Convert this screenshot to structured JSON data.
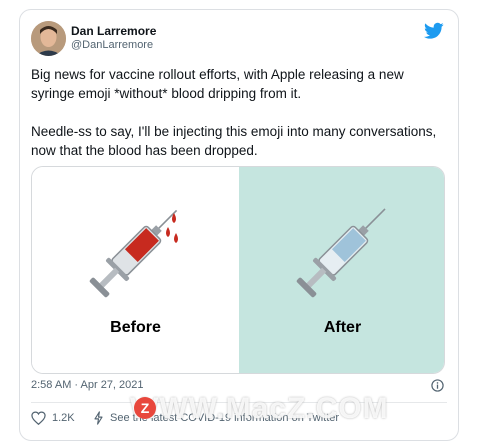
{
  "tweet": {
    "author_name": "Dan Larremore",
    "author_handle": "@DanLarremore",
    "paragraphs": [
      "Big news for vaccine rollout efforts, with Apple releasing a new syringe emoji *without* blood dripping from it.",
      "Needle-ss to say, I'll be injecting this emoji into many conversations, now that the blood has been dropped."
    ],
    "timestamp": "2:58 AM · Apr 27, 2021",
    "likes": "1.2K",
    "share_text": "See the latest COVID-19 information on Twitter",
    "brand_color": "#1d9bf0",
    "icons": {
      "logo": "twitter-bird-icon",
      "info": "info-icon",
      "like": "heart-icon",
      "covid": "lightning-icon"
    }
  },
  "media": {
    "left_label": "Before",
    "right_label": "After",
    "right_bg": "#c5e5df"
  },
  "watermark": {
    "text": "WWW.MacZ.COM",
    "badge": "Z"
  }
}
